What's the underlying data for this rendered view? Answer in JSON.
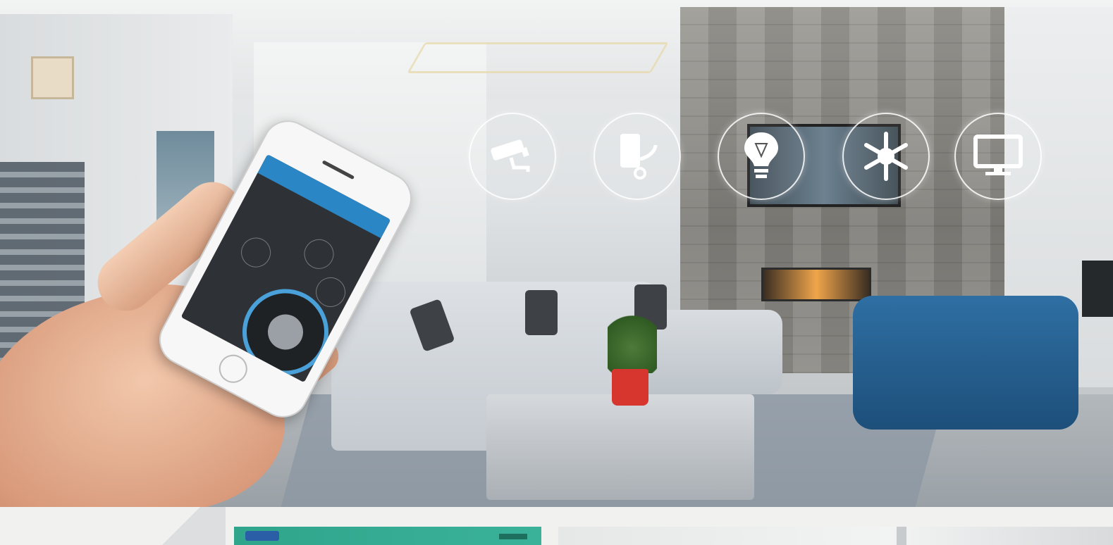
{
  "scene": {
    "title": "",
    "icons": [
      {
        "name": "security-camera-icon"
      },
      {
        "name": "water-heater-icon"
      },
      {
        "name": "light-bulb-icon"
      },
      {
        "name": "snowflake-icon"
      },
      {
        "name": "monitor-icon"
      }
    ]
  },
  "colors": {
    "phone_header": "#2a86c4",
    "chair": "#2f6fa3",
    "pot": "#d6362e",
    "green_panel": "#2fa58b"
  }
}
